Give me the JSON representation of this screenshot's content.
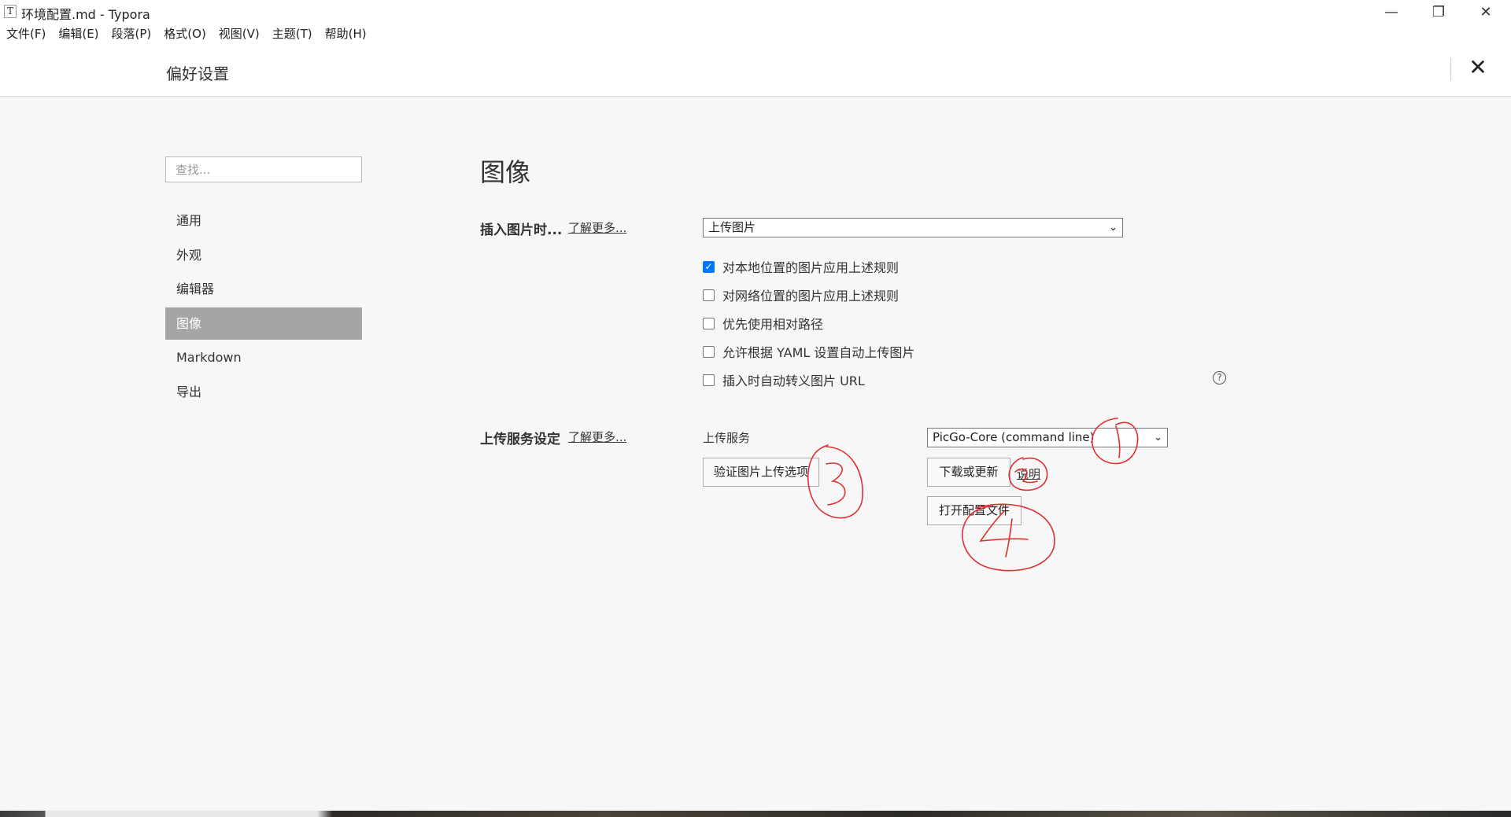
{
  "window": {
    "title": "环境配置.md - Typora",
    "app_icon": "T",
    "controls": {
      "minimize": "—",
      "maximize": "❐",
      "close": "✕"
    }
  },
  "menu": [
    "文件(F)",
    "编辑(E)",
    "段落(P)",
    "格式(O)",
    "视图(V)",
    "主题(T)",
    "帮助(H)"
  ],
  "prefs": {
    "title": "偏好设置",
    "close": "✕",
    "search_placeholder": "查找...",
    "nav": [
      {
        "label": "通用",
        "active": false
      },
      {
        "label": "外观",
        "active": false
      },
      {
        "label": "编辑器",
        "active": false
      },
      {
        "label": "图像",
        "active": true
      },
      {
        "label": "Markdown",
        "active": false
      },
      {
        "label": "导出",
        "active": false
      }
    ]
  },
  "image_section": {
    "title": "图像",
    "insert_label": "插入图片时...",
    "learn_more": "了解更多...",
    "insert_select": "上传图片",
    "options": [
      {
        "label": "对本地位置的图片应用上述规则",
        "checked": true
      },
      {
        "label": "对网络位置的图片应用上述规则",
        "checked": false
      },
      {
        "label": "优先使用相对路径",
        "checked": false
      },
      {
        "label": "允许根据 YAML 设置自动上传图片",
        "checked": false
      },
      {
        "label": "插入时自动转义图片 URL",
        "checked": false
      }
    ],
    "help_icon": "?",
    "upload_label": "上传服务设定",
    "upload_learn_more": "了解更多...",
    "upload_service_label": "上传服务",
    "upload_service_select": "PicGo-Core (command line)",
    "verify_button": "验证图片上传选项",
    "download_button": "下载或更新",
    "explain_link": "说明",
    "open_config_button": "打开配置文件"
  },
  "annotation_color": "#e03030",
  "checkbox_color": "#0075ff"
}
